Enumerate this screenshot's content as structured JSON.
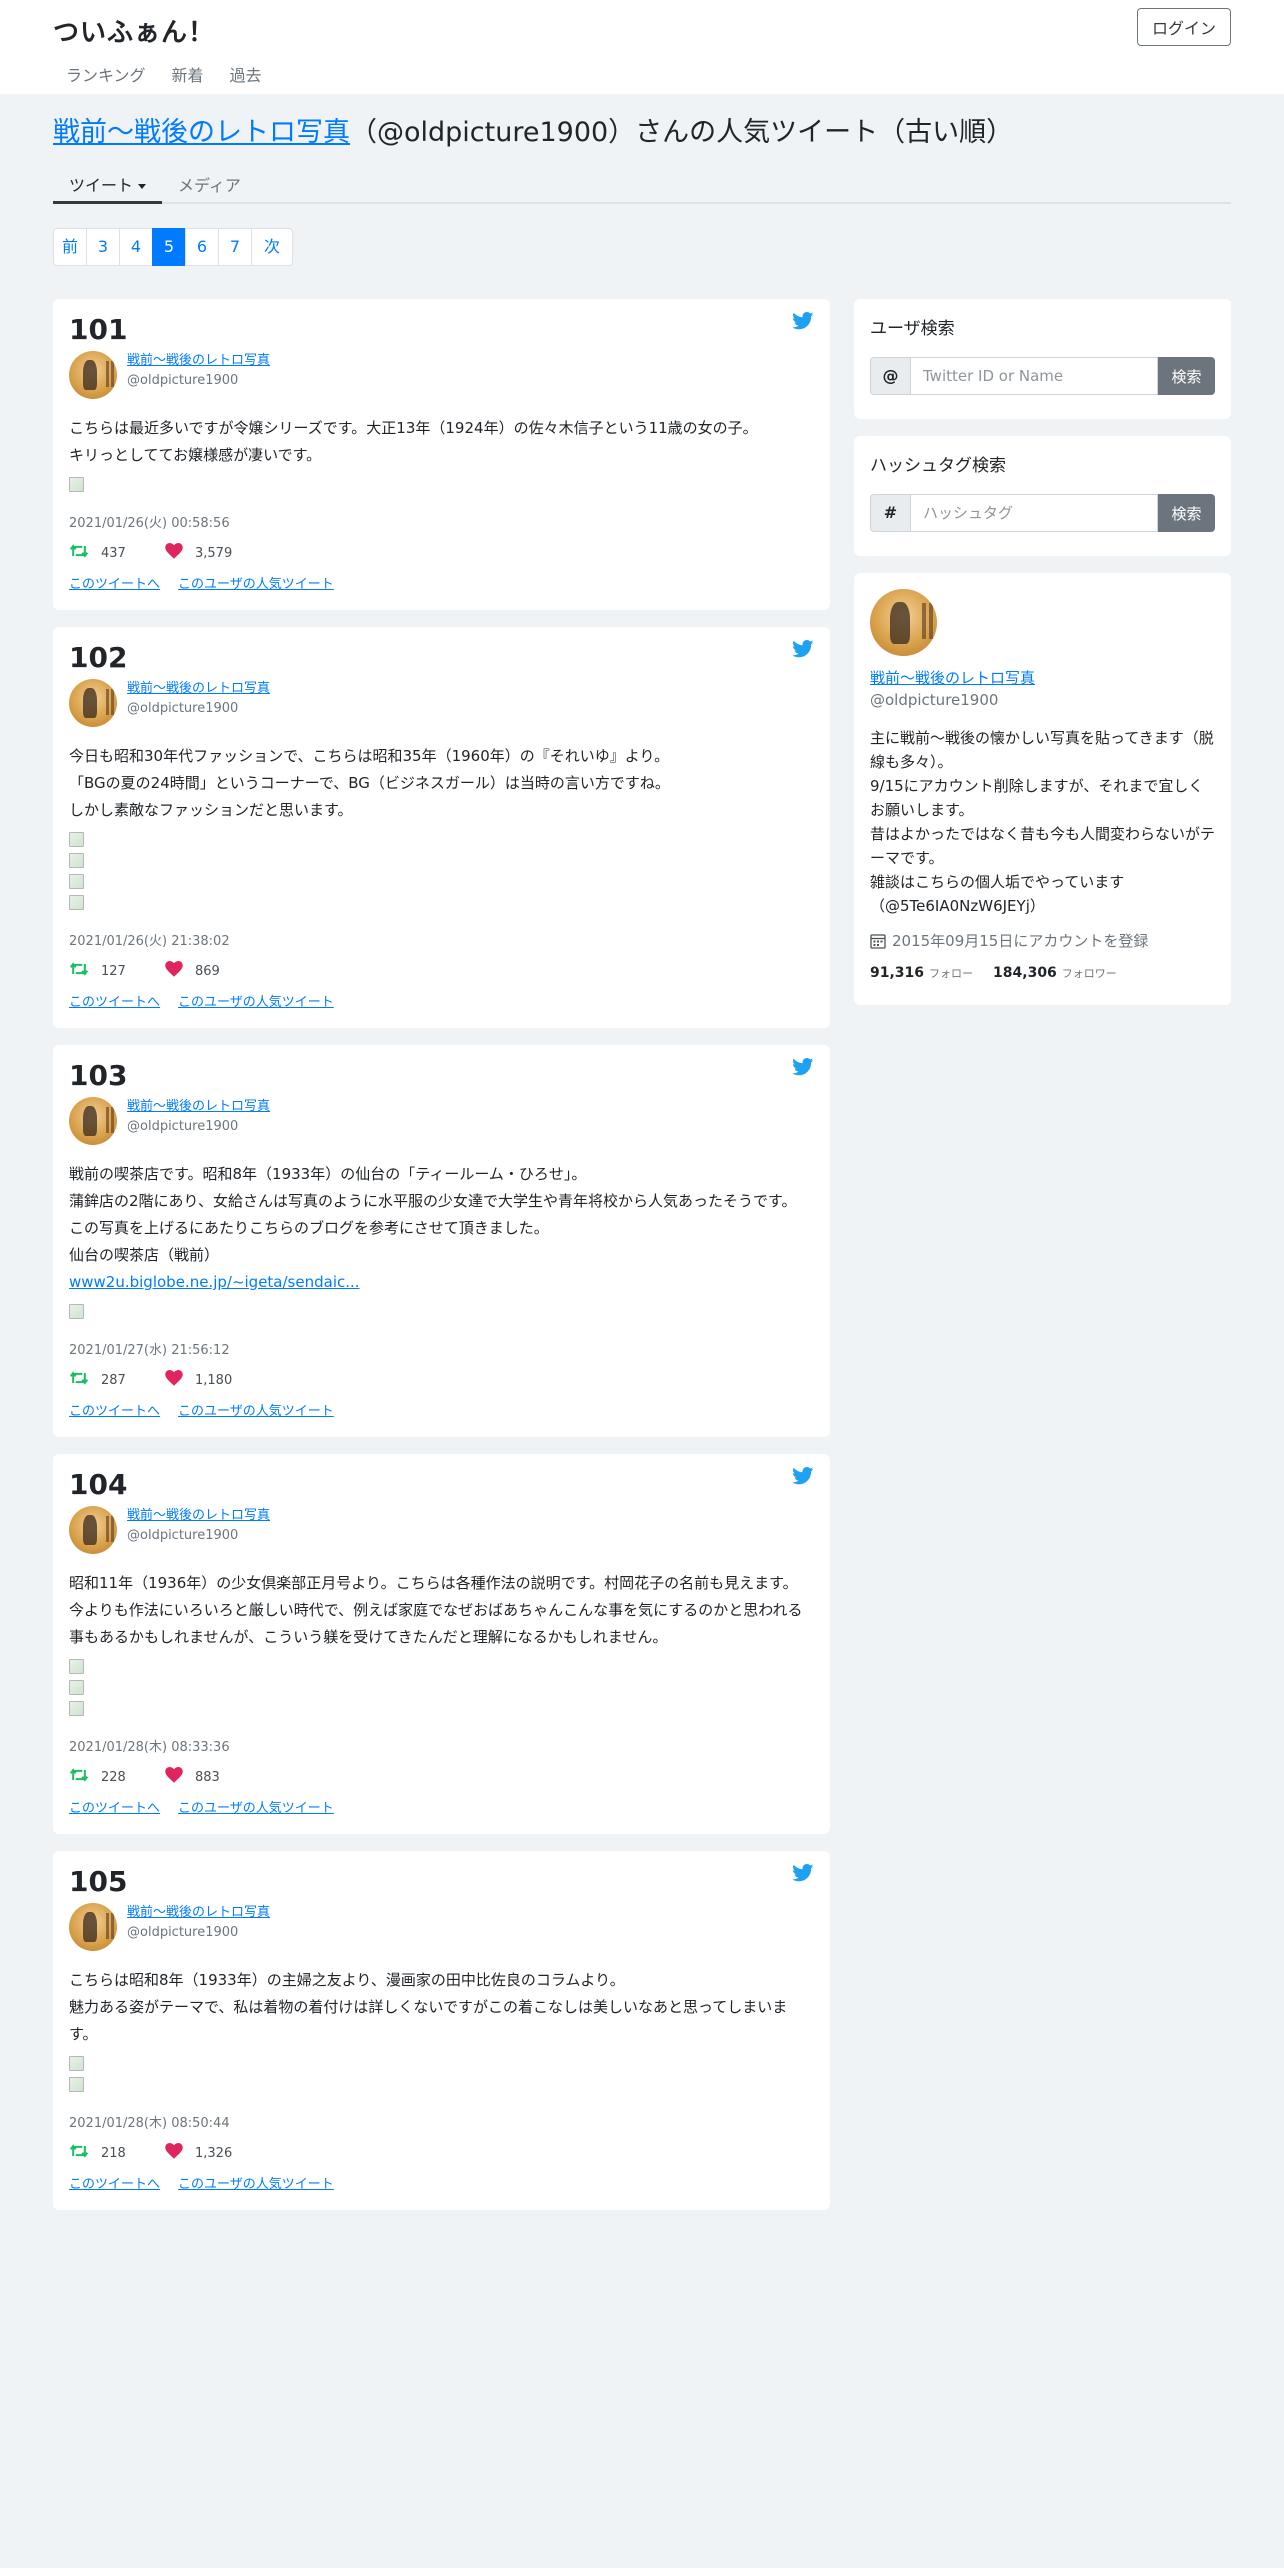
{
  "header": {
    "brand": "ついふぁん！",
    "login_label": "ログイン",
    "nav": [
      "ランキング",
      "新着",
      "過去"
    ]
  },
  "page": {
    "title_link": "戦前～戦後のレトロ写真",
    "title_rest": "（@oldpicture1900）さんの人気ツイート（古い順）",
    "tabs": [
      "ツイート",
      "メディア"
    ],
    "pagination": [
      "前",
      "3",
      "4",
      "5",
      "6",
      "7",
      "次"
    ],
    "active_page": "5"
  },
  "tweets": [
    {
      "rank": "101",
      "author_name": "戦前～戦後のレトロ写真",
      "author_id": "@oldpicture1900",
      "text": "こちらは最近多いですが令嬢シリーズです。大正13年（1924年）の佐々木信子という11歳の女の子。\nキリっとしててお嬢様感が凄いです。",
      "link": "",
      "media_count": 1,
      "timestamp": "2021/01/26(火) 00:58:56",
      "retweets": "437",
      "likes": "3,579",
      "link_tweet": "このツイートへ",
      "link_user": "このユーザの人気ツイート"
    },
    {
      "rank": "102",
      "author_name": "戦前～戦後のレトロ写真",
      "author_id": "@oldpicture1900",
      "text": "今日も昭和30年代ファッションで、こちらは昭和35年（1960年）の『それいゆ』より。\n「BGの夏の24時間」というコーナーで、BG（ビジネスガール）は当時の言い方ですね。\nしかし素敵なファッションだと思います。",
      "link": "",
      "media_count": 4,
      "timestamp": "2021/01/26(火) 21:38:02",
      "retweets": "127",
      "likes": "869",
      "link_tweet": "このツイートへ",
      "link_user": "このユーザの人気ツイート"
    },
    {
      "rank": "103",
      "author_name": "戦前～戦後のレトロ写真",
      "author_id": "@oldpicture1900",
      "text": "戦前の喫茶店です。昭和8年（1933年）の仙台の「ティールーム・ひろせ」。\n蒲鉾店の2階にあり、女給さんは写真のように水平服の少女達で大学生や青年将校から人気あったそうです。\nこの写真を上げるにあたりこちらのブログを参考にさせて頂きました。\n仙台の喫茶店（戦前）",
      "link": "www2u.biglobe.ne.jp/~igeta/sendaic...",
      "media_count": 1,
      "timestamp": "2021/01/27(水) 21:56:12",
      "retweets": "287",
      "likes": "1,180",
      "link_tweet": "このツイートへ",
      "link_user": "このユーザの人気ツイート"
    },
    {
      "rank": "104",
      "author_name": "戦前～戦後のレトロ写真",
      "author_id": "@oldpicture1900",
      "text": "昭和11年（1936年）の少女倶楽部正月号より。こちらは各種作法の説明です。村岡花子の名前も見えます。\n今よりも作法にいろいろと厳しい時代で、例えば家庭でなぜおばあちゃんこんな事を気にするのかと思われる事もあるかもしれませんが、こういう躾を受けてきたんだと理解になるかもしれません。",
      "link": "",
      "media_count": 3,
      "timestamp": "2021/01/28(木) 08:33:36",
      "retweets": "228",
      "likes": "883",
      "link_tweet": "このツイートへ",
      "link_user": "このユーザの人気ツイート"
    },
    {
      "rank": "105",
      "author_name": "戦前～戦後のレトロ写真",
      "author_id": "@oldpicture1900",
      "text": "こちらは昭和8年（1933年）の主婦之友より、漫画家の田中比佐良のコラムより。\n魅力ある姿がテーマで、私は着物の着付けは詳しくないですがこの着こなしは美しいなあと思ってしまいます。",
      "link": "",
      "media_count": 2,
      "timestamp": "2021/01/28(木) 08:50:44",
      "retweets": "218",
      "likes": "1,326",
      "link_tweet": "このツイートへ",
      "link_user": "このユーザの人気ツイート"
    }
  ],
  "sidebar": {
    "user_search": {
      "title": "ユーザ検索",
      "prefix": "@",
      "placeholder": "Twitter ID or Name",
      "button": "検索"
    },
    "hashtag_search": {
      "title": "ハッシュタグ検索",
      "prefix": "#",
      "placeholder": "ハッシュタグ",
      "button": "検索"
    },
    "profile": {
      "name": "戦前～戦後のレトロ写真",
      "id": "@oldpicture1900",
      "bio": "主に戦前～戦後の懐かしい写真を貼ってきます（脱線も多々）。\n9/15にアカウント削除しますが、それまで宜しくお願いします。\n昔はよかったではなく昔も今も人間変わらないがテーマです。\n雑談はこちらの個人垢でやっています（@5Te6IA0NzW6JEYj）",
      "joined": "2015年09月15日にアカウントを登録",
      "following": "91,316",
      "following_label": "フォロー",
      "followers": "184,306",
      "followers_label": "フォロワー"
    }
  },
  "colors": {
    "link": "#007bff",
    "retweet": "#17bf63",
    "like": "#e0245e",
    "twitter": "#1da1f2",
    "page_bg": "#eff3f6"
  }
}
